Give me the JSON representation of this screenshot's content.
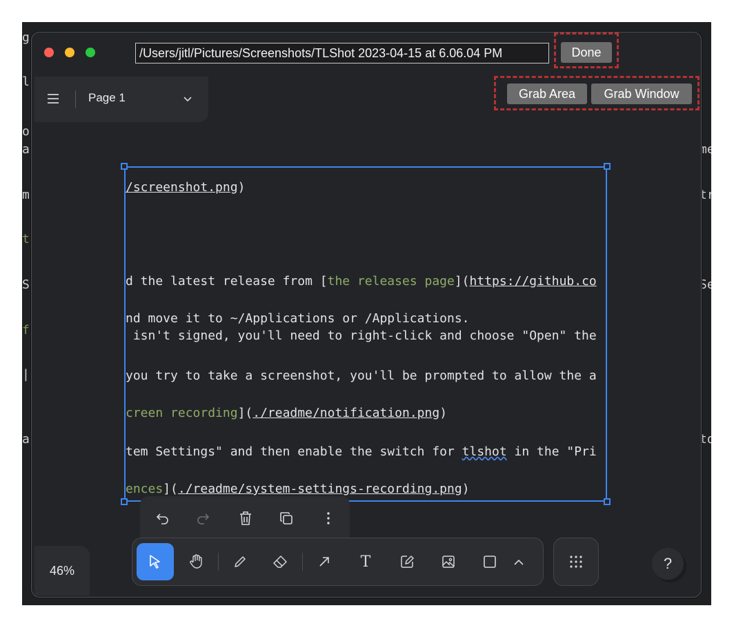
{
  "window": {
    "path": "/Users/jitl/Pictures/Screenshots/TLShot 2023-04-15 at 6.06.04 PM",
    "done_label": "Done",
    "grab_area_label": "Grab Area",
    "grab_window_label": "Grab Window",
    "traffic_lights": {
      "close": "#fe5f57",
      "minimize": "#febc2e",
      "zoom": "#28c840"
    }
  },
  "page_menu": {
    "label": "Page 1",
    "menu_icon": "hamburger-icon",
    "dropdown_icon": "chevron-down-icon"
  },
  "background_fragments": [
    "g",
    "le/",
    "o",
    "ap",
    "me",
    "mo",
    "tr",
    "t",
    "Sy",
    "Se",
    "f",
    "|",
    "as",
    "to"
  ],
  "document_lines": [
    {
      "segments": [
        {
          "text": "/screenshot.png",
          "style": "link"
        },
        {
          "text": ")",
          "style": "plain"
        }
      ]
    },
    {
      "segments": [
        {
          "text": "d the latest release from [",
          "style": "plain"
        },
        {
          "text": "the releases page",
          "style": "green"
        },
        {
          "text": "](",
          "style": "plain"
        },
        {
          "text": "https://github.co",
          "style": "link"
        }
      ]
    },
    {
      "segments": [
        {
          "text": "nd move it to ~/Applications or /Applications.",
          "style": "plain"
        }
      ]
    },
    {
      "segments": [
        {
          "text": " isn't signed, you'll need to right-click and choose \"Open\" the",
          "style": "plain"
        }
      ]
    },
    {
      "segments": [
        {
          "text": "you try to take a screenshot, you'll be prompted to allow the a",
          "style": "plain"
        }
      ]
    },
    {
      "segments": [
        {
          "text": "creen recording",
          "style": "green"
        },
        {
          "text": "](",
          "style": "plain"
        },
        {
          "text": "./readme/notification.png",
          "style": "link"
        },
        {
          "text": ")",
          "style": "plain"
        }
      ]
    },
    {
      "segments": [
        {
          "text": "tem Settings\" and then enable the switch for ",
          "style": "plain"
        },
        {
          "text": "tlshot",
          "style": "squiggle"
        },
        {
          "text": " in the \"Pri",
          "style": "plain"
        }
      ]
    },
    {
      "segments": [
        {
          "text": "ences",
          "style": "green"
        },
        {
          "text": "](",
          "style": "plain"
        },
        {
          "text": "./readme/system-settings-recording.png",
          "style": "link"
        },
        {
          "text": ")",
          "style": "plain"
        }
      ]
    }
  ],
  "context_toolbar": {
    "items": [
      "undo-icon",
      "redo-icon",
      "trash-icon",
      "duplicate-icon",
      "more-vertical-icon"
    ]
  },
  "main_toolbar": {
    "items": [
      "select-icon",
      "hand-icon",
      "pencil-icon",
      "eraser-icon",
      "arrow-icon",
      "text-icon",
      "note-icon",
      "image-icon",
      "rectangle-icon",
      "chevron-up-icon"
    ],
    "active": "select-icon",
    "active_color": "#3f87f0"
  },
  "grid_button": {
    "icon": "grid-icon"
  },
  "zoom": {
    "level": "46%"
  },
  "help": {
    "label": "?"
  },
  "highlight_color": "#b53232"
}
